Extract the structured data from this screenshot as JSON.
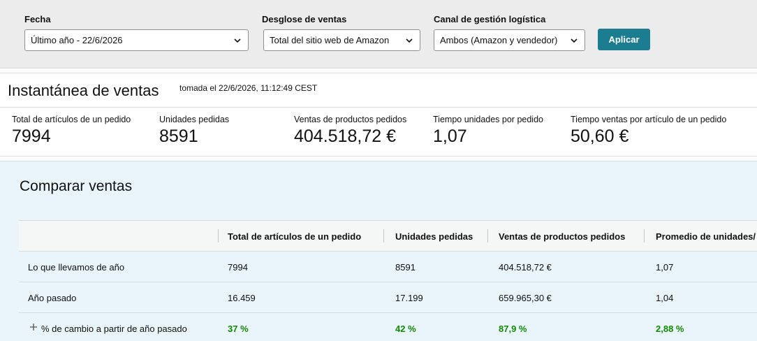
{
  "filters": {
    "date": {
      "label": "Fecha",
      "value": "Último año - 22/6/2026"
    },
    "breakdown": {
      "label": "Desglose de ventas",
      "value": "Total del sitio web de Amazon"
    },
    "channel": {
      "label": "Canal de gestión logística",
      "value": "Ambos (Amazon y vendedor)"
    },
    "apply_label": "Aplicar"
  },
  "snapshot": {
    "title": "Instantánea de ventas",
    "taken": "tomada el 22/6/2026, 11:12:49 CEST",
    "metrics": [
      {
        "label": "Total de artículos de un pedido",
        "value": "7994"
      },
      {
        "label": "Unidades pedidas",
        "value": "8591"
      },
      {
        "label": "Ventas de productos pedidos",
        "value": "404.518,72 €"
      },
      {
        "label": "Tiempo unidades por pedido",
        "value": "1,07"
      },
      {
        "label": "Tiempo ventas por artículo de un pedido",
        "value": "50,60 €"
      }
    ]
  },
  "compare": {
    "title": "Comparar ventas",
    "headers": [
      "",
      "Total de artículos de un pedido",
      "Unidades pedidas",
      "Ventas de productos pedidos",
      "Promedio de unidades/"
    ],
    "rows": [
      [
        "Lo que llevamos de año",
        "7994",
        "8591",
        "404.518,72 €",
        "1,07"
      ],
      [
        "Año pasado",
        "16.459",
        "17.199",
        "659.965,30 €",
        "1,04"
      ],
      [
        "% de cambio a partir de año pasado",
        "37 %",
        "42 %",
        "87,9 %",
        "2,88 %"
      ]
    ]
  },
  "colors": {
    "accent": "#1b7d8f",
    "positive": "#108a00",
    "compare_bg": "#e9f4fb"
  },
  "icons": [
    "chevron-down-icon",
    "plus-icon"
  ]
}
